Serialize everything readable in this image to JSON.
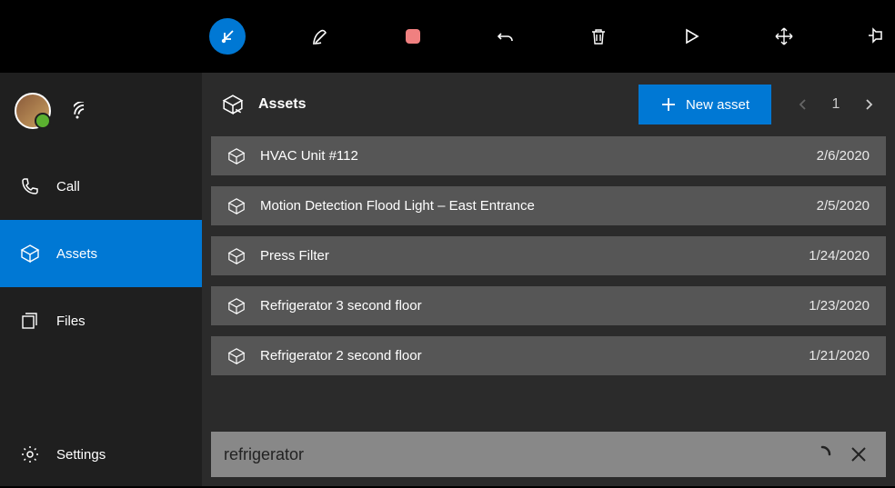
{
  "colors": {
    "accent": "#0078d4"
  },
  "sidebar": {
    "items": [
      {
        "label": "Call"
      },
      {
        "label": "Assets"
      },
      {
        "label": "Files"
      },
      {
        "label": "Settings"
      }
    ]
  },
  "header": {
    "title": "Assets",
    "new_button": "New asset",
    "page": "1"
  },
  "assets": [
    {
      "name": "HVAC Unit #112",
      "date": "2/6/2020"
    },
    {
      "name": "Motion Detection Flood Light – East Entrance",
      "date": "2/5/2020"
    },
    {
      "name": "Press Filter",
      "date": "1/24/2020"
    },
    {
      "name": "Refrigerator 3 second floor",
      "date": "1/23/2020"
    },
    {
      "name": "Refrigerator 2 second floor",
      "date": "1/21/2020"
    }
  ],
  "search": {
    "value": "refrigerator"
  }
}
